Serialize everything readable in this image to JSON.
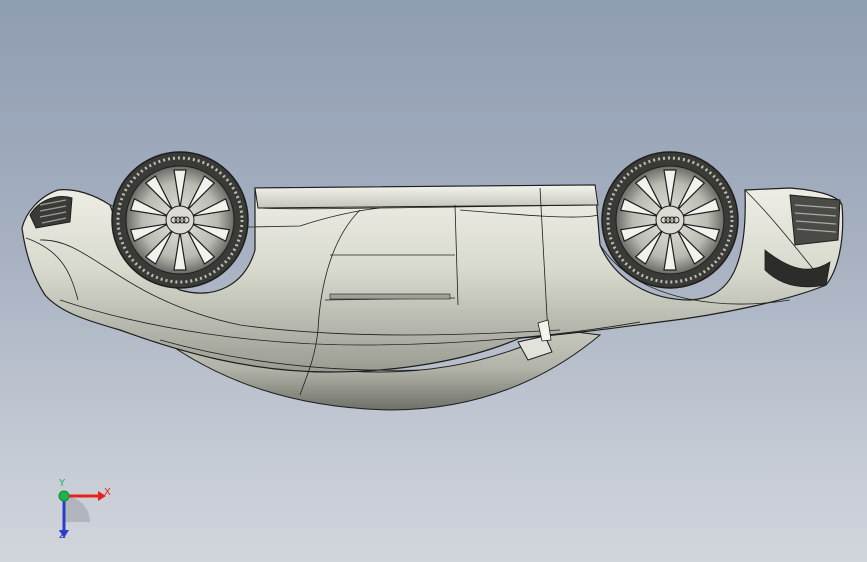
{
  "viewport": {
    "background_top": "#8f9db2",
    "background_bottom": "#d1d5dc",
    "model_name": ""
  },
  "model": {
    "body_color": "#d6d7cc",
    "edge_color": "#1e1e1e",
    "shade_color": "#8d8f86"
  },
  "triad": {
    "x_label": "X",
    "y_label": "Y",
    "z_label": "Z",
    "x_color": "#e8201c",
    "y_color": "#22b24c",
    "z_color": "#2c3cc8"
  }
}
